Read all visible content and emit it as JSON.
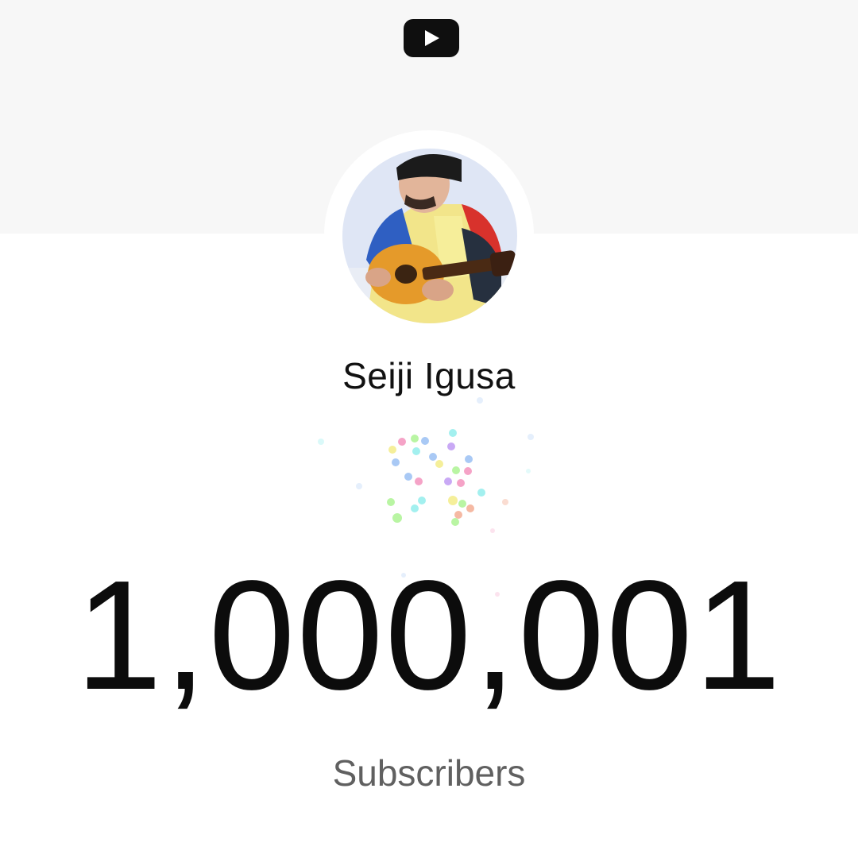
{
  "header": {
    "logo_icon": "youtube-play-icon",
    "logo_color": "#0f0f0f",
    "background": "#f7f7f7"
  },
  "channel": {
    "avatar": "channel-avatar-guitarist",
    "name": "Seiji Igusa"
  },
  "counter": {
    "value": "1,000,001",
    "label": "Subscribers"
  },
  "confetti_colors": [
    "#f5a3c7",
    "#a9c9f5",
    "#b9f5a3",
    "#f5ef9a",
    "#c9a9f5",
    "#a3f0ef",
    "#f5b9a3"
  ]
}
